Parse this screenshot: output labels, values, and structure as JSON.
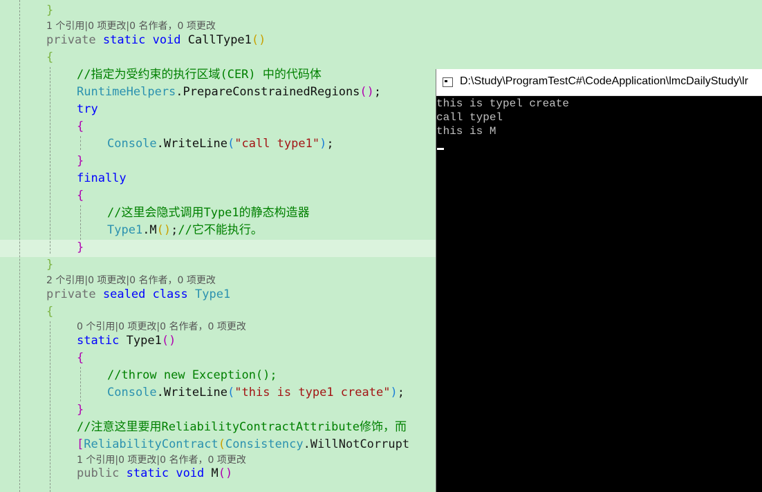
{
  "editor": {
    "lines": {
      "l1": "}",
      "lens1": "1 个引用|0 项更改|0 名作者，0 项更改",
      "l2_private": "private",
      "l2_static": "static",
      "l2_void": "void",
      "l2_name": "CallType1",
      "l2_parens": "()",
      "l3": "{",
      "l4": "//指定为受约束的执行区域(CER) 中的代码体",
      "l5_class": "RuntimeHelpers",
      "l5_dot": ".",
      "l5_method": "PrepareConstrainedRegions",
      "l5_parens": "()",
      "l5_semi": ";",
      "l6": "try",
      "l7": "{",
      "l8_class": "Console",
      "l8_method": ".WriteLine",
      "l8_open": "(",
      "l8_str": "\"call type1\"",
      "l8_close": ")",
      "l8_semi": ";",
      "l9": "}",
      "l10": "finally",
      "l11": "{",
      "l12": "//这里会隐式调用Type1的静态构造器",
      "l13_class": "Type1",
      "l13_method": ".M",
      "l13_parens": "()",
      "l13_semi": ";",
      "l13_comment": "//它不能执行。",
      "l14": "}",
      "l15": "}",
      "lens2": "2 个引用|0 项更改|0 名作者，0 项更改",
      "l16_private": "private",
      "l16_sealed": "sealed",
      "l16_class": "class",
      "l16_name": "Type1",
      "l17": "{",
      "lens3": "0 个引用|0 项更改|0 名作者，0 项更改",
      "l18_static": "static",
      "l18_name": "Type1",
      "l18_parens": "()",
      "l19": "{",
      "l20": "//throw new Exception();",
      "l21_class": "Console",
      "l21_method": ".WriteLine",
      "l21_open": "(",
      "l21_str": "\"this is type1 create\"",
      "l21_close": ")",
      "l21_semi": ";",
      "l22": "}",
      "l23": "//注意这里要用ReliabilityContractAttribute修饰，而",
      "l24_open": "[",
      "l24_attr": "ReliabilityContract",
      "l24_paren": "(",
      "l24_enum": "Consistency",
      "l24_rest": ".WillNotCorrupt",
      "lens4": "1 个引用|0 项更改|0 名作者，0 项更改",
      "l25_public": "public",
      "l25_static": "static",
      "l25_void": "void",
      "l25_name": "M",
      "l25_parens": "()"
    }
  },
  "console": {
    "title": "D:\\Study\\ProgramTestC#\\CodeApplication\\lmcDailyStudy\\lr",
    "output": [
      "this is typel create",
      "call typel",
      "this is M"
    ]
  },
  "colors": {
    "editor_bg": "#c7edcc",
    "keyword": "#0000ff",
    "type": "#2b91af",
    "string": "#a31515",
    "comment": "#008000",
    "console_bg": "#000000"
  }
}
